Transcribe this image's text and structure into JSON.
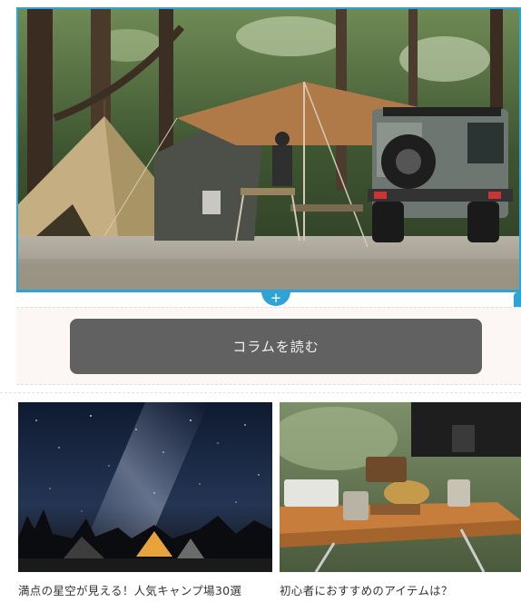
{
  "hero": {
    "image": "camp-site-photo",
    "insert_symbol": "+"
  },
  "cta": {
    "label": "コラムを読む",
    "button_color": "#616161"
  },
  "articles": [
    {
      "title": "満点の星空が見える！人気キャンプ場30選",
      "image": "starry-sky-campsite-photo"
    },
    {
      "title": "初心者におすすめのアイテムは？",
      "image": "camp-gear-table-photo"
    }
  ],
  "colors": {
    "selection_accent": "#2ea3d6",
    "block_background": "#fcf6f4"
  }
}
